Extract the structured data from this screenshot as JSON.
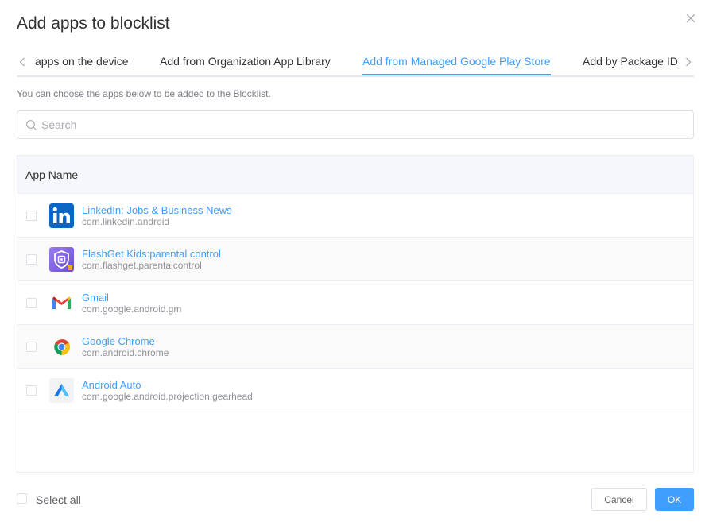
{
  "dialog": {
    "title": "Add apps to blocklist"
  },
  "tabs": [
    {
      "label": "apps on the device",
      "active": false
    },
    {
      "label": "Add from Organization App Library",
      "active": false
    },
    {
      "label": "Add from Managed Google Play Store",
      "active": true
    },
    {
      "label": "Add by Package ID",
      "active": false
    }
  ],
  "hint": "You can choose the apps below to be added to the Blocklist.",
  "search": {
    "placeholder": "Search",
    "value": ""
  },
  "table": {
    "column_header": "App Name",
    "rows": [
      {
        "name": "LinkedIn: Jobs & Business News",
        "package": "com.linkedin.android",
        "icon": "linkedin-icon",
        "checked": false
      },
      {
        "name": "FlashGet Kids:parental control",
        "package": "com.flashget.parentalcontrol",
        "icon": "flashget-kids-icon",
        "checked": false
      },
      {
        "name": "Gmail",
        "package": "com.google.android.gm",
        "icon": "gmail-icon",
        "checked": false
      },
      {
        "name": "Google Chrome",
        "package": "com.android.chrome",
        "icon": "chrome-icon",
        "checked": false
      },
      {
        "name": "Android Auto",
        "package": "com.google.android.projection.gearhead",
        "icon": "android-auto-icon",
        "checked": false
      }
    ]
  },
  "footer": {
    "select_all_label": "Select all",
    "cancel_label": "Cancel",
    "ok_label": "OK"
  },
  "colors": {
    "accent": "#409eff",
    "linkedin": "#0a66c2",
    "flashget": "#7b5cd6"
  }
}
